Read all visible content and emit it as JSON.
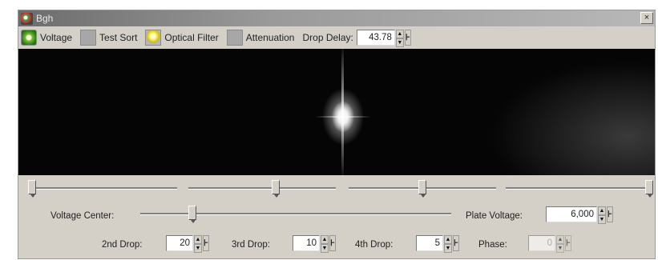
{
  "window": {
    "title": "Bgh",
    "close_glyph": "×"
  },
  "toolbar": {
    "voltage_label": "Voltage",
    "test_sort_label": "Test Sort",
    "optical_filter_label": "Optical Filter",
    "attenuation_label": "Attenuation",
    "drop_delay_label": "Drop Delay:",
    "drop_delay_value": "43.78"
  },
  "icons": {
    "voltage": "voltage-indicator-icon",
    "test_sort": "test-sort-toggle-icon",
    "optical_filter": "optical-filter-bulb-icon",
    "attenuation": "attenuation-toggle-icon"
  },
  "sliders": {
    "top_slider_1": 0.0,
    "top_slider_2": 0.6,
    "top_slider_3": 0.5,
    "top_slider_4": 1.0,
    "voltage_center": 0.16
  },
  "controls": {
    "voltage_center_label": "Voltage Center:",
    "plate_voltage_label": "Plate Voltage:",
    "plate_voltage_value": "6,000",
    "drop2_label": "2nd Drop:",
    "drop2_value": "20",
    "drop3_label": "3rd Drop:",
    "drop3_value": "10",
    "drop4_label": "4th Drop:",
    "drop4_value": "5",
    "phase_label": "Phase:",
    "phase_value": "0"
  },
  "spinner_glyphs": {
    "up": "▲",
    "down": "▼",
    "bar": "⊦"
  }
}
